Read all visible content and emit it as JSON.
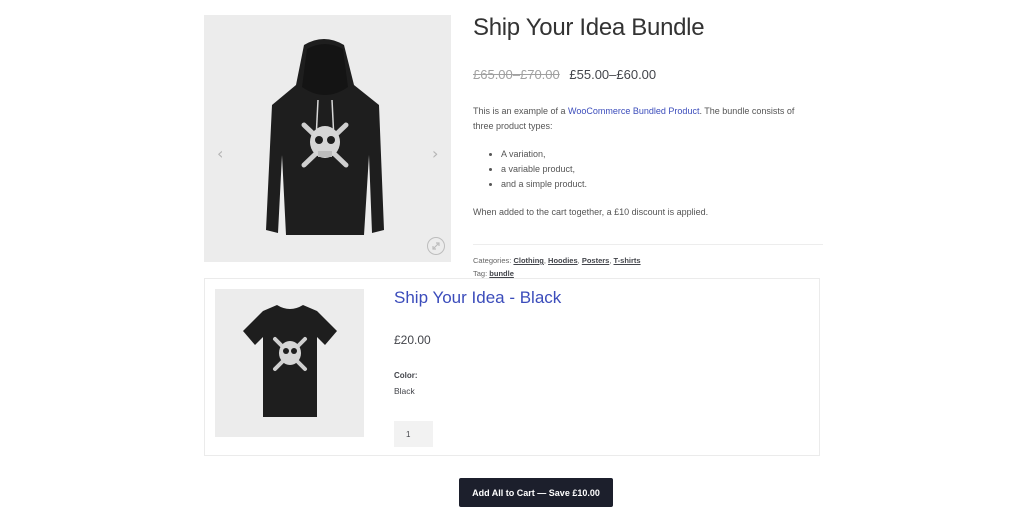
{
  "product": {
    "title": "Ship Your Idea Bundle",
    "price_regular": "£65.00–£70.00",
    "price_sale": "£55.00–£60.00",
    "description": {
      "intro_before_link": "This is an example of a ",
      "link_text": "WooCommerce Bundled Product",
      "intro_after_link": ". The bundle consists of three product types:",
      "bullets": [
        "A variation,",
        "a variable product,",
        "and a simple product."
      ],
      "note": "When added to the cart together, a £10 discount is applied."
    },
    "meta": {
      "categories_label": "Categories:",
      "categories": [
        "Clothing",
        "Hoodies",
        "Posters",
        "T-shirts"
      ],
      "tag_label": "Tag:",
      "tag": "bundle"
    }
  },
  "gallery": {
    "prev_icon": "‹",
    "next_icon": "›"
  },
  "bundled_item": {
    "title": "Ship Your Idea - Black",
    "price": "£20.00",
    "attribute_label": "Color:",
    "attribute_value": "Black",
    "quantity": "1"
  },
  "cart": {
    "button_label": "Add All to Cart — Save £10.00"
  },
  "colors": {
    "link": "#3b4cbb",
    "button_bg": "#1c1f2c",
    "image_bg": "#ececec"
  }
}
